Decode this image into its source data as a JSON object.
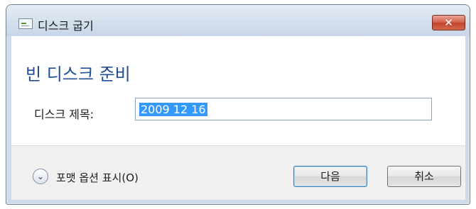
{
  "window": {
    "title": "디스크 굽기",
    "close_glyph": "✕"
  },
  "main": {
    "heading": "빈 디스크 준비",
    "disc_title_label": "디스크 제목:",
    "disc_title_value": "2009 12 16"
  },
  "footer": {
    "expand_glyph": "⌄",
    "expand_label": "포맷 옵션 표시(O)",
    "next_label": "다음",
    "cancel_label": "취소"
  },
  "colors": {
    "heading": "#1f4e96",
    "selection": "#3399ff",
    "close_button": "#c0412c"
  },
  "icons": [
    "burn-disc-icon",
    "close-icon",
    "chevron-down-icon"
  ]
}
